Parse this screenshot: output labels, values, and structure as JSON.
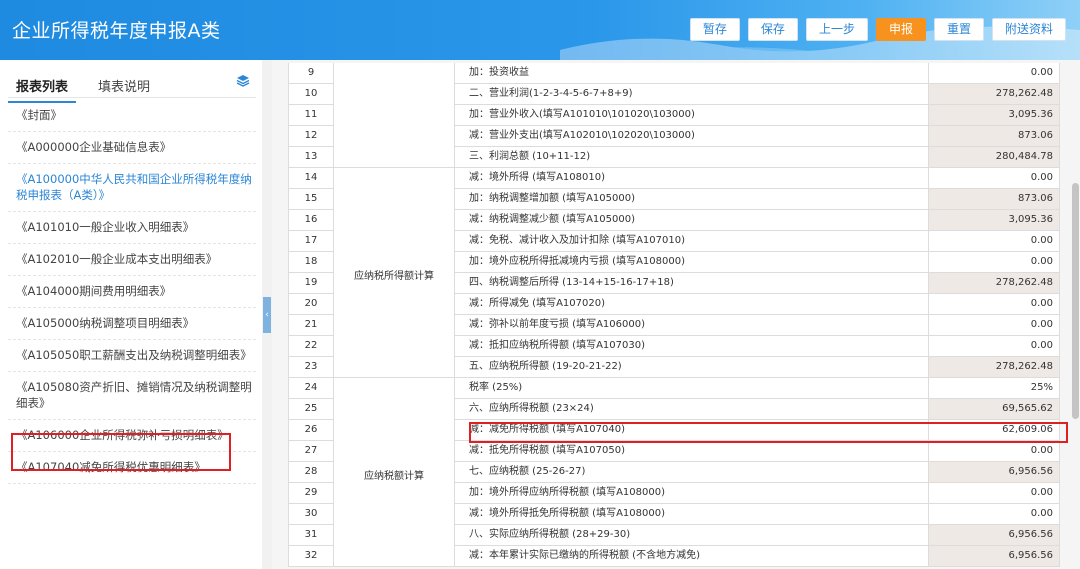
{
  "header": {
    "title": "企业所得税年度申报A类",
    "buttons": [
      "暂存",
      "保存",
      "上一步",
      "申报",
      "重置",
      "附送资料"
    ]
  },
  "sidebar": {
    "tabs": [
      "报表列表",
      "填表说明"
    ],
    "items": [
      "《封面》",
      "《A000000企业基础信息表》",
      "《A100000中华人民共和国企业所得税年度纳税申报表（A类）》",
      "《A101010一般企业收入明细表》",
      "《A102010一般企业成本支出明细表》",
      "《A104000期间费用明细表》",
      "《A105000纳税调整项目明细表》",
      "《A105050职工薪酬支出及纳税调整明细表》",
      "《A105080资产折旧、摊销情况及纳税调整明细表》",
      "《A106000企业所得税弥补亏损明细表》",
      "《A107040减免所得税优惠明细表》"
    ]
  },
  "table": {
    "categories": [
      "应纳税所得额计算",
      "应纳税额计算"
    ],
    "rows": [
      {
        "no": "9",
        "name": "加：投资收益",
        "value": "0.00"
      },
      {
        "no": "10",
        "name": "二、营业利润(1-2-3-4-5-6-7+8+9)",
        "value": "278,262.48"
      },
      {
        "no": "11",
        "name": "加：营业外收入(填写A101010\\101020\\103000)",
        "value": "3,095.36"
      },
      {
        "no": "12",
        "name": "减：营业外支出(填写A102010\\102020\\103000)",
        "value": "873.06"
      },
      {
        "no": "13",
        "name": "三、利润总额 (10+11-12)",
        "value": "280,484.78"
      },
      {
        "no": "14",
        "name": "减：境外所得 (填写A108010)",
        "value": "0.00"
      },
      {
        "no": "15",
        "name": "加：纳税调整增加额 (填写A105000)",
        "value": "873.06"
      },
      {
        "no": "16",
        "name": "减：纳税调整减少额 (填写A105000)",
        "value": "3,095.36"
      },
      {
        "no": "17",
        "name": "减：免税、减计收入及加计扣除 (填写A107010)",
        "value": "0.00"
      },
      {
        "no": "18",
        "name": "加：境外应税所得抵减境内亏损 (填写A108000)",
        "value": "0.00"
      },
      {
        "no": "19",
        "name": "四、纳税调整后所得 (13-14+15-16-17+18)",
        "value": "278,262.48"
      },
      {
        "no": "20",
        "name": "减：所得减免 (填写A107020)",
        "value": "0.00"
      },
      {
        "no": "21",
        "name": "减：弥补以前年度亏损 (填写A106000)",
        "value": "0.00"
      },
      {
        "no": "22",
        "name": "减：抵扣应纳税所得额 (填写A107030)",
        "value": "0.00"
      },
      {
        "no": "23",
        "name": "五、应纳税所得额 (19-20-21-22)",
        "value": "278,262.48"
      },
      {
        "no": "24",
        "name": "税率 (25%)",
        "value": "25%"
      },
      {
        "no": "25",
        "name": "六、应纳所得税额 (23×24)",
        "value": "69,565.62"
      },
      {
        "no": "26",
        "name": "减：减免所得税额 (填写A107040)",
        "value": "62,609.06"
      },
      {
        "no": "27",
        "name": "减：抵免所得税额 (填写A107050)",
        "value": "0.00"
      },
      {
        "no": "28",
        "name": "七、应纳税额 (25-26-27)",
        "value": "6,956.56"
      },
      {
        "no": "29",
        "name": "加：境外所得应纳所得税额 (填写A108000)",
        "value": "0.00"
      },
      {
        "no": "30",
        "name": "减：境外所得抵免所得税额 (填写A108000)",
        "value": "0.00"
      },
      {
        "no": "31",
        "name": "八、实际应纳所得税额 (28+29-30)",
        "value": "6,956.56"
      },
      {
        "no": "32",
        "name": "减：本年累计实际已缴纳的所得税额 (不含地方减免)",
        "value": "6,956.56"
      }
    ]
  },
  "colors": {
    "header_blue": "#1e8ae0",
    "primary_button": "#f7921e",
    "link_blue": "#2b86d6",
    "highlight_red": "#e02020",
    "calc_cell_bg": "#efe9e6"
  }
}
